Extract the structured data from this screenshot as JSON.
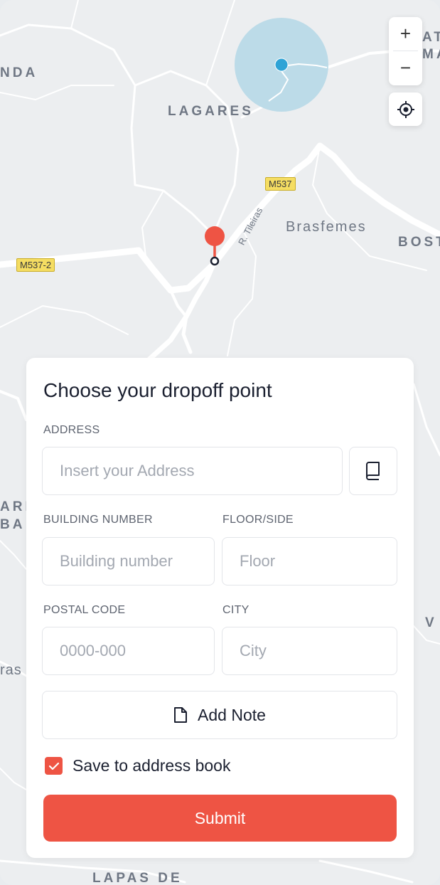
{
  "map": {
    "labels": {
      "nda": "NDA",
      "lagares": "LAGARES",
      "brasfemes": "Brasfemes",
      "bost": "BOST",
      "at": "AT",
      "ma": "MA",
      "ari": "ARI",
      "ba": "BA",
      "v": "V",
      "ras": "ras",
      "lapas": "LAPAS DE"
    },
    "road_badges": {
      "m537": "M537",
      "m537_2": "M537-2"
    },
    "street": "R. Tileiras",
    "controls": {
      "zoom_in": "+",
      "zoom_out": "−"
    },
    "colors": {
      "accent": "#ee5444",
      "location_dot": "#2ea3d6",
      "location_halo": "#bcdbe8"
    }
  },
  "form": {
    "title": "Choose your dropoff point",
    "address_label": "ADDRESS",
    "address_placeholder": "Insert your Address",
    "building_label": "BUILDING NUMBER",
    "building_placeholder": "Building number",
    "floor_label": "FLOOR/SIDE",
    "floor_placeholder": "Floor",
    "postal_label": "POSTAL CODE",
    "postal_placeholder": "0000-000",
    "city_label": "CITY",
    "city_placeholder": "City",
    "note_label": "Add Note",
    "save_label": "Save to address book",
    "save_checked": true,
    "submit_label": "Submit"
  }
}
